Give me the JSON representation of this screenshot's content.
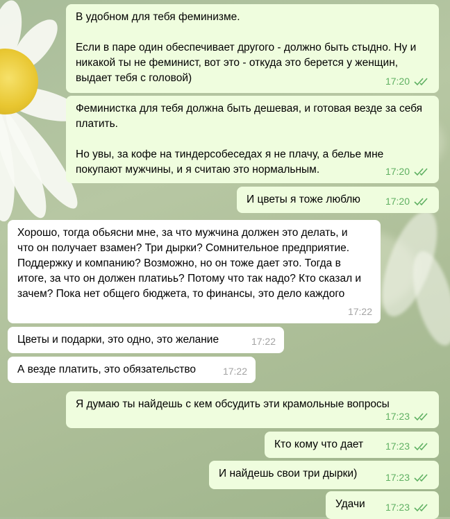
{
  "messages": [
    {
      "dir": "out",
      "text": "В удобном для тебя феминизме.\n\nЕсли в паре один обеспечивает другого - должно быть стыдно. Ну и никакой ты не феминист, вот это - откуда это берется у женщин, выдает тебя с головой)",
      "time": "17:20",
      "status_icon": "double-check-icon"
    },
    {
      "dir": "out",
      "text": "Феминистка для тебя должна быть дешевая, и готовая везде за себя платить.\n\nНо увы, за кофе на тиндерсобеседах я не плачу, а белье мне покупают мужчины, и я считаю это нормальным.",
      "time": "17:20",
      "status_icon": "double-check-icon"
    },
    {
      "dir": "out",
      "text": "И цветы я тоже люблю",
      "time": "17:20",
      "status_icon": "double-check-icon"
    },
    {
      "dir": "in",
      "text": "Хорошо, тогда обьясни мне, за что мужчина должен это делать, и что он получает взамен? Три дырки? Сомнительное предприятие. Поддержку и компанию? Возможно, но он тоже дает это. Тогда в итоге, за что он должен платиьь? Потому что так надо? Кто сказал и зачем? Пока нет общего бюджета, то финансы, это дело каждого",
      "time": "17:22"
    },
    {
      "dir": "in",
      "text": "Цветы и подарки, это одно, это желание",
      "time": "17:22"
    },
    {
      "dir": "in",
      "text": "А везде платить, это обязательство",
      "time": "17:22"
    },
    {
      "dir": "out",
      "text": "Я думаю ты найдешь с кем обсудить эти крамольные вопросы",
      "time": "17:23",
      "status_icon": "double-check-icon"
    },
    {
      "dir": "out",
      "text": "Кто кому что дает",
      "time": "17:23",
      "status_icon": "double-check-icon"
    },
    {
      "dir": "out",
      "text": "И найдешь свои три дырки)",
      "time": "17:23",
      "status_icon": "double-check-icon"
    },
    {
      "dir": "out",
      "text": "Удачи",
      "time": "17:23",
      "status_icon": "double-check-icon"
    }
  ],
  "colors": {
    "outgoing_bubble": "#effdde",
    "incoming_bubble": "#ffffff",
    "outgoing_meta": "#5fb062",
    "incoming_meta": "#a3a3a3"
  }
}
